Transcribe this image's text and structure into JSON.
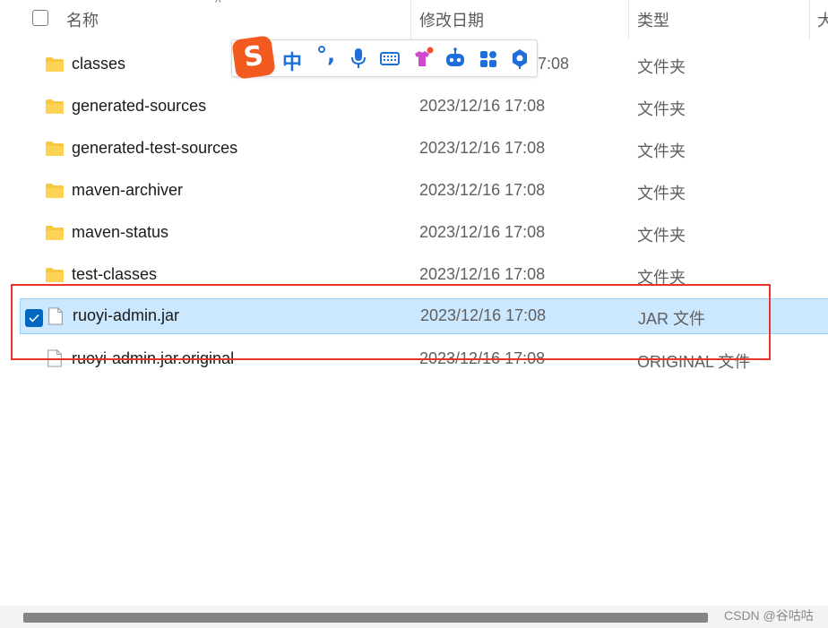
{
  "header": {
    "name": "名称",
    "date_modified": "修改日期",
    "type": "类型",
    "size": "大"
  },
  "files": [
    {
      "name": "classes",
      "date": "",
      "type": "文件夹",
      "kind": "folder"
    },
    {
      "name": "generated-sources",
      "date": "2023/12/16 17:08",
      "type": "文件夹",
      "kind": "folder"
    },
    {
      "name": "generated-test-sources",
      "date": "2023/12/16 17:08",
      "type": "文件夹",
      "kind": "folder"
    },
    {
      "name": "maven-archiver",
      "date": "2023/12/16 17:08",
      "type": "文件夹",
      "kind": "folder"
    },
    {
      "name": "maven-status",
      "date": "2023/12/16 17:08",
      "type": "文件夹",
      "kind": "folder"
    },
    {
      "name": "test-classes",
      "date": "2023/12/16 17:08",
      "type": "文件夹",
      "kind": "folder"
    },
    {
      "name": "ruoyi-admin.jar",
      "date": "2023/12/16 17:08",
      "type": "JAR 文件",
      "kind": "file",
      "selected": true
    },
    {
      "name": "ruoyi-admin.jar.original",
      "date": "2023/12/16 17:08",
      "type": "ORIGINAL 文件",
      "kind": "file"
    }
  ],
  "partial_date_row0": "17:08",
  "ime": {
    "logo": "S",
    "chinese_mode": "中",
    "punctuation": "°,",
    "icons": [
      "microphone-icon",
      "keyboard-icon",
      "skin-icon",
      "robot-icon",
      "toolbox-icon",
      "settings-icon"
    ]
  },
  "watermark": "CSDN @谷咕咕",
  "colors": {
    "selected_row": "#cce8ff",
    "highlight_box": "#e8352a",
    "checkbox": "#0067c0",
    "folder": "#f8c940",
    "ime_brand": "#f25a20",
    "ime_accent": "#1e6fd9"
  }
}
